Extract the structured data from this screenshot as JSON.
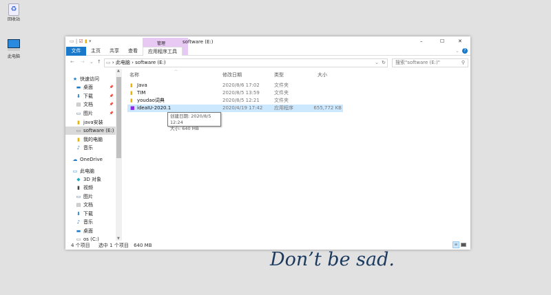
{
  "desktop": {
    "icons": [
      {
        "label": "回收站",
        "icon": "recycle-bin-icon"
      },
      {
        "label": "此电脑",
        "icon": "computer-icon"
      }
    ]
  },
  "window": {
    "title": "software (E:)",
    "context_tab": "管理",
    "context_subtab": "应用程序工具",
    "ribbon_tabs": [
      "文件",
      "主页",
      "共享",
      "查看"
    ],
    "controls": {
      "minimize": "–",
      "maximize": "☐",
      "close": "✕"
    },
    "address": {
      "crumbs": [
        "此电脑",
        "software (E:)"
      ]
    },
    "search": {
      "placeholder": "搜索\"software (E:)\""
    },
    "nav": [
      {
        "label": "快速访问",
        "icon": "star-icon",
        "pinned": false
      },
      {
        "label": "桌面",
        "icon": "desktop-icon",
        "pinned": true
      },
      {
        "label": "下载",
        "icon": "download-icon",
        "pinned": true
      },
      {
        "label": "文档",
        "icon": "document-icon",
        "pinned": true
      },
      {
        "label": "图片",
        "icon": "picture-icon",
        "pinned": true
      },
      {
        "label": "java安装",
        "icon": "folder-icon",
        "pinned": false
      },
      {
        "label": "software (E:)",
        "icon": "drive-icon",
        "pinned": false,
        "selected": true
      },
      {
        "label": "我的电脑",
        "icon": "folder-icon",
        "pinned": false
      },
      {
        "label": "音乐",
        "icon": "music-icon",
        "pinned": false
      },
      {
        "label": "OneDrive",
        "icon": "cloud-icon",
        "pinned": false
      },
      {
        "label": "此电脑",
        "icon": "computer-icon",
        "pinned": false
      },
      {
        "label": "3D 对象",
        "icon": "cube-icon",
        "pinned": false
      },
      {
        "label": "视频",
        "icon": "video-icon",
        "pinned": false
      },
      {
        "label": "图片",
        "icon": "picture-icon",
        "pinned": false
      },
      {
        "label": "文档",
        "icon": "document-icon",
        "pinned": false
      },
      {
        "label": "下载",
        "icon": "download-icon",
        "pinned": false
      },
      {
        "label": "音乐",
        "icon": "music-icon",
        "pinned": false
      },
      {
        "label": "桌面",
        "icon": "desktop-icon",
        "pinned": false
      },
      {
        "label": "os (C:)",
        "icon": "drive-icon",
        "pinned": false
      }
    ],
    "columns": [
      "名称",
      "修改日期",
      "类型",
      "大小"
    ],
    "files": [
      {
        "name": "Java",
        "date": "2020/8/6 17:02",
        "type": "文件夹",
        "size": "",
        "icon": "folder-icon"
      },
      {
        "name": "TIM",
        "date": "2020/8/5 13:59",
        "type": "文件夹",
        "size": "",
        "icon": "folder-icon"
      },
      {
        "name": "youdao词典",
        "date": "2020/8/5 12:21",
        "type": "文件夹",
        "size": "",
        "icon": "folder-icon"
      },
      {
        "name": "ideaIU-2020.1",
        "date": "2020/4/19 17:42",
        "type": "应用程序",
        "size": "655,772 KB",
        "icon": "intellij-icon",
        "selected": true
      }
    ],
    "tooltip": {
      "line1": "创建日期: 2020/8/5 12:24",
      "line2": "大小: 640 MB"
    },
    "status": {
      "count": "4 个项目",
      "selected": "选中 1 个项目",
      "size": "640 MB"
    }
  },
  "slogan": "Don’t be sad.",
  "colors": {
    "accent": "#1979ca",
    "selection": "#cce8ff",
    "context": "#e8c9f3"
  }
}
